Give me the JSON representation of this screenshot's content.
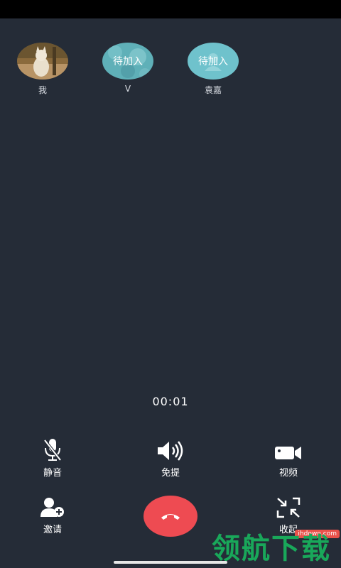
{
  "participants": [
    {
      "name": "我",
      "status": ""
    },
    {
      "name": "V",
      "status": "待加入"
    },
    {
      "name": "袁嘉",
      "status": "待加入"
    }
  ],
  "timer": "00:01",
  "controls": {
    "mute": {
      "label": "静音",
      "icon": "mic-off-icon"
    },
    "speaker": {
      "label": "免提",
      "icon": "speaker-icon"
    },
    "video": {
      "label": "视频",
      "icon": "video-camera-icon"
    },
    "invite": {
      "label": "邀请",
      "icon": "add-user-icon"
    },
    "minimize": {
      "label": "收起",
      "icon": "collapse-icon"
    },
    "hangup": {
      "icon": "hangup-phone-icon",
      "color": "#ee4b52"
    }
  },
  "watermark": {
    "url": "ihdown.com",
    "text": "领航下载"
  },
  "colors": {
    "background": "#252c37",
    "pending_avatar": "#6fc2cc"
  }
}
